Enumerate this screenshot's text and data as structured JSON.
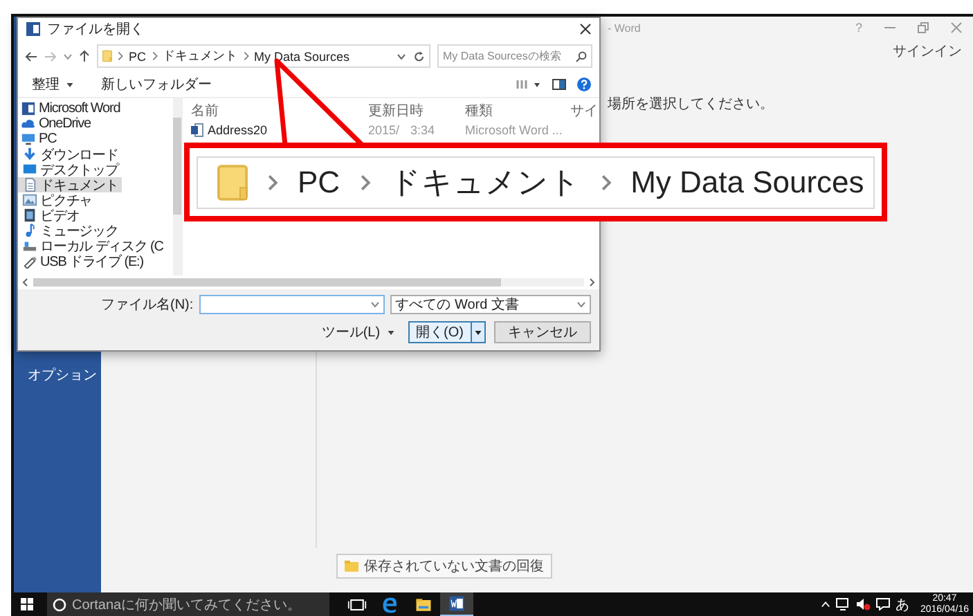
{
  "word_window": {
    "title": "- Word",
    "help_button": "?",
    "sign_in": "サインイン",
    "prompt": "場所を選択してください。",
    "sidebar": {
      "items": [
        {
          "label": "オプション",
          "selected": false
        }
      ]
    },
    "recover_button": "保存されていない文書の回復"
  },
  "dialog": {
    "title": "ファイルを開く",
    "breadcrumb": [
      "PC",
      "ドキュメント",
      "My Data Sources"
    ],
    "search_placeholder": "My Data Sourcesの検索",
    "toolbar": {
      "organize": "整理",
      "new_folder": "新しいフォルダー"
    },
    "nav_items": [
      {
        "kind": "word",
        "label": "Microsoft Word",
        "selected": false
      },
      {
        "kind": "cloud",
        "label": "OneDrive",
        "selected": false
      },
      {
        "kind": "pc",
        "label": "PC",
        "selected": false
      },
      {
        "kind": "download",
        "label": "ダウンロード",
        "selected": false
      },
      {
        "kind": "desktop",
        "label": "デスクトップ",
        "selected": false
      },
      {
        "kind": "documents",
        "label": "ドキュメント",
        "selected": true
      },
      {
        "kind": "pictures",
        "label": "ピクチャ",
        "selected": false
      },
      {
        "kind": "videos",
        "label": "ビデオ",
        "selected": false
      },
      {
        "kind": "music",
        "label": "ミュージック",
        "selected": false
      },
      {
        "kind": "disk",
        "label": "ローカル ディスク (C",
        "selected": false
      },
      {
        "kind": "usb",
        "label": "USB ドライブ (E:)",
        "selected": false
      }
    ],
    "columns": [
      "名前",
      "更新日時",
      "種類",
      "サイ"
    ],
    "files": [
      {
        "name": "Address20",
        "modified_parts": [
          "2015/",
          "3:34"
        ],
        "type": "Microsoft Word ..."
      }
    ],
    "filename_label": "ファイル名(N):",
    "file_type": "すべての Word 文書",
    "tools": "ツール(L)",
    "open": "開く(O)",
    "cancel": "キャンセル"
  },
  "callout": {
    "breadcrumb": [
      "PC",
      "ドキュメント",
      "My Data Sources"
    ]
  },
  "taskbar": {
    "search_placeholder": "Cortanaに何か聞いてみてください。",
    "apps": [
      {
        "kind": "task-view",
        "selected": false
      },
      {
        "kind": "edge",
        "selected": false
      },
      {
        "kind": "explorer",
        "selected": false
      },
      {
        "kind": "word",
        "selected": true
      }
    ],
    "ime": "あ",
    "time": "20:47",
    "date": "2016/04/16"
  }
}
